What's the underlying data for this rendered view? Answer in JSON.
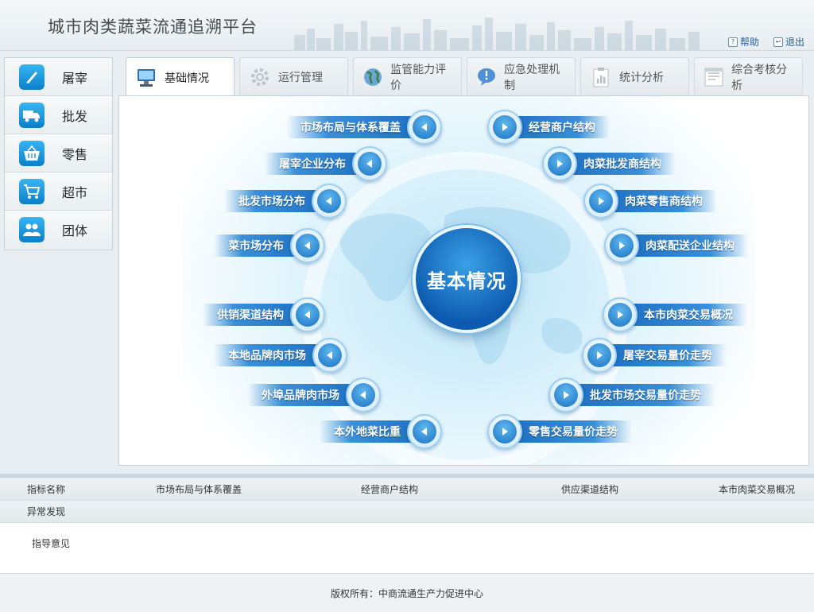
{
  "header": {
    "title": "城市肉类蔬菜流通追溯平台",
    "help_label": "帮助",
    "logout_label": "退出"
  },
  "sidebar": {
    "items": [
      {
        "label": "屠宰",
        "icon": "knife-icon"
      },
      {
        "label": "批发",
        "icon": "truck-icon"
      },
      {
        "label": "零售",
        "icon": "basket-icon"
      },
      {
        "label": "超市",
        "icon": "cart-icon"
      },
      {
        "label": "团体",
        "icon": "group-icon"
      }
    ]
  },
  "tabs": [
    {
      "label": "基础情况",
      "icon": "monitor-icon",
      "active": true
    },
    {
      "label": "运行管理",
      "icon": "gear-icon",
      "active": false
    },
    {
      "label": "监管能力评价",
      "icon": "globe-icon",
      "active": false
    },
    {
      "label": "应急处理机制",
      "icon": "alert-bubble-icon",
      "active": false
    },
    {
      "label": "统计分析",
      "icon": "clipboard-icon",
      "active": false
    },
    {
      "label": "综合考核分析",
      "icon": "report-icon",
      "active": false
    }
  ],
  "diagram": {
    "center_label": "基本情况",
    "left_nodes": [
      "市场布局与体系覆盖",
      "屠宰企业分布",
      "批发市场分布",
      "菜市场分布",
      "供销渠道结构",
      "本地品牌肉市场",
      "外埠品牌肉市场",
      "本外地菜比重"
    ],
    "right_nodes": [
      "经营商户结构",
      "肉菜批发商结构",
      "肉菜零售商结构",
      "肉菜配送企业结构",
      "本市肉菜交易概况",
      "屠宰交易量价走势",
      "批发市场交易量价走势",
      "零售交易量价走势"
    ]
  },
  "info": {
    "row1": {
      "label": "指标名称",
      "values": [
        "市场布局与体系覆盖",
        "经营商户结构",
        "供应渠道结构",
        "本市肉菜交易概况"
      ]
    },
    "row2": {
      "label": "异常发现"
    },
    "row3": {
      "label": "指导意见"
    }
  },
  "footer": {
    "copyright": "版权所有：中商流通生产力促进中心"
  },
  "colors": {
    "accent": "#1c6fc0",
    "link": "#1f5f9e"
  }
}
